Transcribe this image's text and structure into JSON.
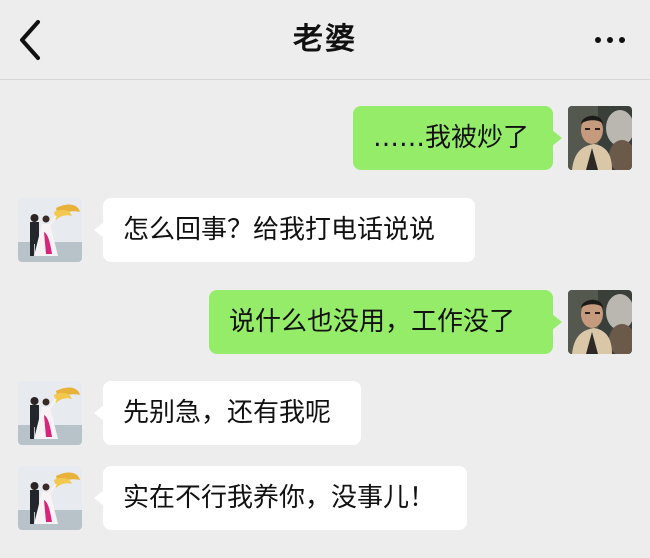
{
  "header": {
    "title": "老婆",
    "back_icon": "chevron-left-icon",
    "more_icon": "more-dots-icon"
  },
  "colors": {
    "sent_bubble": "#95ec69",
    "received_bubble": "#ffffff",
    "background": "#ededed"
  },
  "messages": [
    {
      "side": "sent",
      "text": "……我被炒了"
    },
    {
      "side": "received",
      "text": "怎么回事？给我打电话说说"
    },
    {
      "side": "sent",
      "text": "说什么也没用，工作没了"
    },
    {
      "side": "received",
      "text": "先别急，还有我呢"
    },
    {
      "side": "received",
      "text": "实在不行我养你，没事儿！"
    }
  ]
}
